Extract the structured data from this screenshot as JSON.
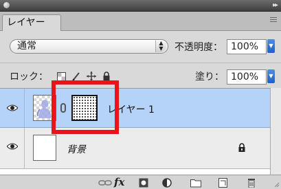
{
  "panel": {
    "tab_label": "レイヤー",
    "icons": {
      "close": "close-dot-icon",
      "collapse": "double-chevron-right-icon",
      "menu": "panel-menu-icon"
    }
  },
  "blend": {
    "mode_value": "通常",
    "opacity_label": "不透明度：",
    "opacity_value": "100%"
  },
  "lock": {
    "label": "ロック：",
    "fill_label": "塗り：",
    "fill_value": "100%",
    "icons": [
      "lock-transparent-pixels-icon",
      "lock-image-pixels-icon",
      "lock-position-icon",
      "lock-all-icon"
    ]
  },
  "layers": [
    {
      "name": "レイヤー 1",
      "selected": true,
      "has_mask": true
    },
    {
      "name": "背景",
      "selected": false,
      "locked": true
    }
  ],
  "bottom_toolbar": {
    "icons": [
      "link-layers-icon",
      "fx-icon",
      "add-mask-icon",
      "adjustment-layer-icon",
      "new-group-icon",
      "new-layer-icon",
      "delete-icon"
    ],
    "fx_label": "fx"
  },
  "colors": {
    "selected_row": "#b5d3f9",
    "highlight_annotation": "#e8141a",
    "stepper_blue": "#2f6fd6"
  }
}
